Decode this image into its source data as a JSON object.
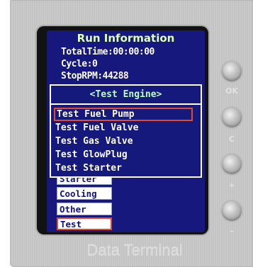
{
  "header": {
    "title": "Run Information",
    "total_time": "TotalTime:00:00:00",
    "cycle": "Cycle:0",
    "stop_rpm": "StopRPM:44288"
  },
  "menu": {
    "items": [
      {
        "label": "Starter"
      },
      {
        "label": "Cooling"
      },
      {
        "label": "Other"
      },
      {
        "label": "Test"
      }
    ],
    "selected_index": 3
  },
  "popup": {
    "title": "<Test Engine>",
    "items": [
      {
        "label": "Test Fuel Pump"
      },
      {
        "label": "Test Fuel Valve"
      },
      {
        "label": "Test Gas Valve"
      },
      {
        "label": "Test GlowPlug"
      },
      {
        "label": "Test Starter"
      }
    ],
    "selected_index": 0
  },
  "buttons": {
    "labels": [
      "OK",
      "C",
      "+",
      "–"
    ]
  },
  "device": {
    "brand": "Data Terminal"
  },
  "colors": {
    "screen_bg": "#16187e",
    "selection_border": "#e24a2a",
    "title_color": "#e0ffb0",
    "device_body": "#c9c9c9"
  }
}
